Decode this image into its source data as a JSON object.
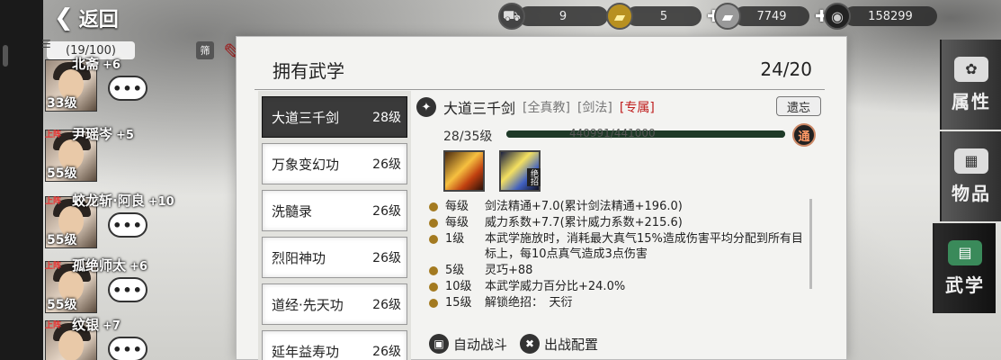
{
  "nav": {
    "back_label": "返回"
  },
  "currencies": [
    {
      "icon": "cart-icon",
      "value": "9"
    },
    {
      "icon": "gold-ingot-icon",
      "value": "5"
    },
    {
      "icon": "silver-ingot-icon",
      "value": "7749"
    },
    {
      "icon": "coin-icon",
      "value": "158299"
    }
  ],
  "roster": {
    "count": "(19/100)",
    "filter_label": "筛",
    "characters": [
      {
        "name": "北斋",
        "bonus": "+6",
        "level": "33级",
        "badge": "",
        "chat": "•••"
      },
      {
        "name": "尹瑶岑",
        "bonus": "+5",
        "level": "55级",
        "badge": "上阵",
        "chat": "•••"
      },
      {
        "name": "蛟龙斩·阿良",
        "bonus": "+10",
        "level": "55级",
        "badge": "上阵",
        "chat": "•••"
      },
      {
        "name": "孤绝师太",
        "bonus": "+6",
        "level": "55级",
        "badge": "上阵",
        "chat": "•••"
      },
      {
        "name": "纹银",
        "bonus": "+7",
        "level": "",
        "badge": "上阵",
        "chat": "•••"
      }
    ]
  },
  "panel": {
    "title": "拥有武学",
    "capacity": "24/20",
    "skills": [
      {
        "name": "大道三千剑",
        "level": "28级",
        "active": true
      },
      {
        "name": "万象变幻功",
        "level": "26级",
        "active": false
      },
      {
        "name": "洗髓录",
        "level": "26级",
        "active": false
      },
      {
        "name": "烈阳神功",
        "level": "26级",
        "active": false
      },
      {
        "name": "道经·先天功",
        "level": "26级",
        "active": false
      },
      {
        "name": "延年益寿功",
        "level": "26级",
        "active": false
      }
    ]
  },
  "detail": {
    "name": "大道三千剑",
    "tag_sect": "[全真教]",
    "tag_type": "[剑法]",
    "tag_exclusive": "[专属]",
    "forget_label": "遗忘",
    "level": "28/35级",
    "exp": "440991/441000",
    "exp_fraction": 0.99998,
    "tong_label": "通",
    "slot_ult_label": "绝招",
    "effects": [
      {
        "req": "每级",
        "desc": "剑法精通+7.0(累计剑法精通+196.0)"
      },
      {
        "req": "每级",
        "desc": "威力系数+7.7(累计威力系数+215.6)"
      },
      {
        "req": "1级",
        "desc": "本武学施放时，消耗最大真气15%造成伤害平均分配到所有目标上，每10点真气造成3点伤害"
      },
      {
        "req": "5级",
        "desc": "灵巧+88"
      },
      {
        "req": "10级",
        "desc": "本武学威力百分比+24.0%"
      },
      {
        "req": "15级",
        "desc": "解锁绝招：　天衍"
      }
    ],
    "auto_battle_label": "自动战斗",
    "deploy_label": "出战配置"
  },
  "right_tabs": [
    {
      "label": "属性",
      "icon": "attribute-icon",
      "active": false
    },
    {
      "label": "物品",
      "icon": "item-box-icon",
      "active": false
    },
    {
      "label": "武学",
      "icon": "martial-book-icon",
      "active": true
    }
  ],
  "colors": {
    "exclusive_tag": "#c02020",
    "level_dot": "#a37a20",
    "active_skill": "#3a3a3a"
  }
}
